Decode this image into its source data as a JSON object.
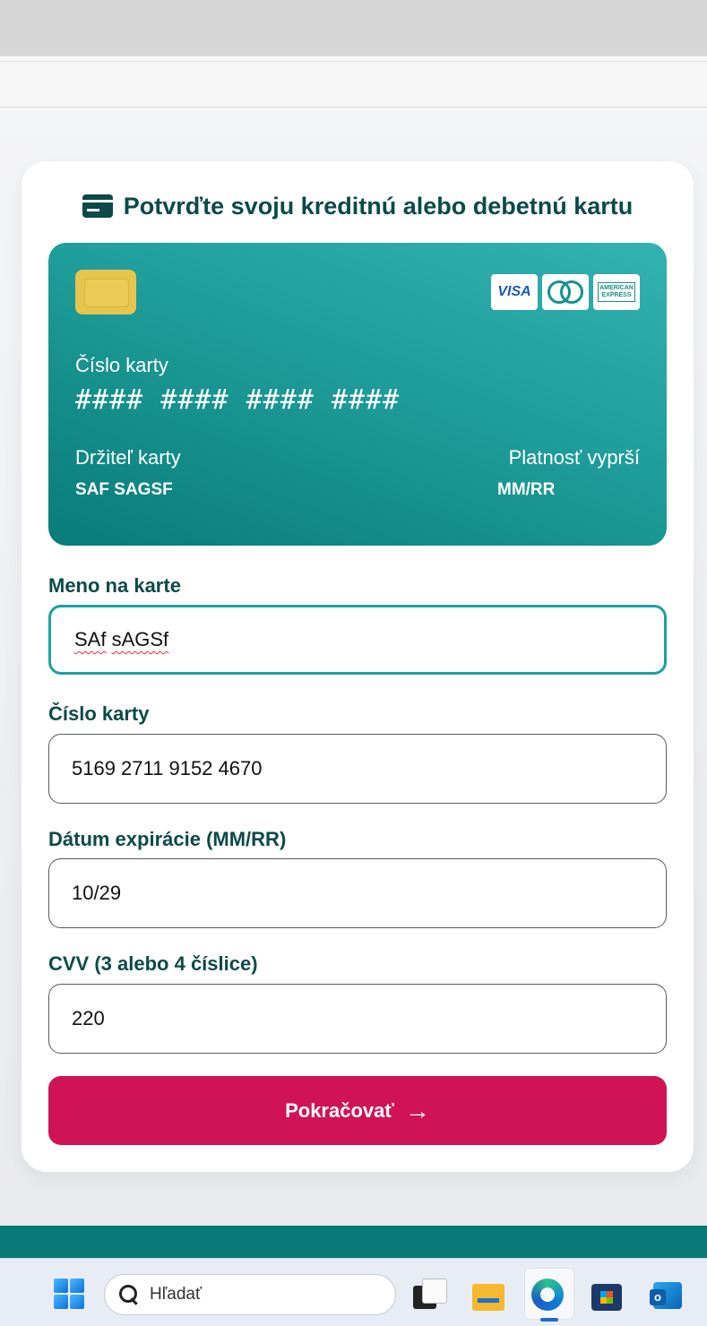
{
  "page": {
    "heading": "Potvrďte svoju kreditnú alebo debetnú kartu"
  },
  "card_preview": {
    "brands": [
      "VISA",
      "mastercard",
      "AMERICAN EXPRESS"
    ],
    "number_label": "Číslo karty",
    "number_value": "#### #### #### ####",
    "holder_label": "Držiteľ karty",
    "holder_value": "SAF SAGSF",
    "expiry_label": "Platnosť vyprší",
    "expiry_value": "MM/RR"
  },
  "form": {
    "name_label": "Meno na karte",
    "name_value_part1": "SAf",
    "name_value_part2": "sAGSf",
    "number_label": "Číslo karty",
    "number_value": "5169 2711 9152 4670",
    "expiry_label": "Dátum expirácie (MM/RR)",
    "expiry_value": "10/29",
    "cvv_label": "CVV (3 alebo 4 číslice)",
    "cvv_value": "220",
    "submit_label": "Pokračovať",
    "submit_arrow": "→"
  },
  "taskbar": {
    "search_placeholder": "Hľadať",
    "icons": [
      "start-icon",
      "task-view-icon",
      "file-explorer-icon",
      "edge-icon",
      "store-icon",
      "outlook-icon"
    ]
  },
  "colors": {
    "accent_teal": "#087a77",
    "heading": "#0b4a48",
    "submit": "#d01354",
    "focus_border": "#1aa3a0"
  }
}
